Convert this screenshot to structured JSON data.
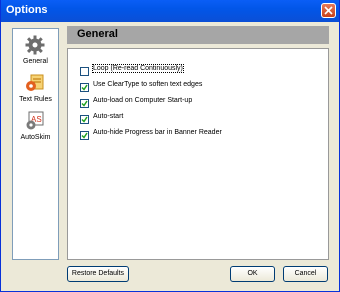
{
  "window": {
    "title": "Options"
  },
  "sidebar": {
    "items": [
      {
        "label": "General",
        "icon": "gear-icon"
      },
      {
        "label": "Text Rules",
        "icon": "text-rules-icon"
      },
      {
        "label": "AutoSkim",
        "icon": "autoskim-icon"
      }
    ]
  },
  "panel": {
    "title": "General",
    "options": [
      {
        "label": "Loop (Re-read Continuously)",
        "checked": false
      },
      {
        "label": "Use ClearType to soften text edges",
        "checked": true
      },
      {
        "label": "Auto-load on Computer Start-up",
        "checked": true
      },
      {
        "label": "Auto-start",
        "checked": true
      },
      {
        "label": "Auto-hide Progress bar in Banner Reader",
        "checked": true
      }
    ]
  },
  "buttons": {
    "restore": "Restore Defaults",
    "ok": "OK",
    "cancel": "Cancel"
  },
  "colors": {
    "title_bar": "#0a5ef6",
    "close": "#c8401a",
    "header": "#a6a6a6"
  }
}
